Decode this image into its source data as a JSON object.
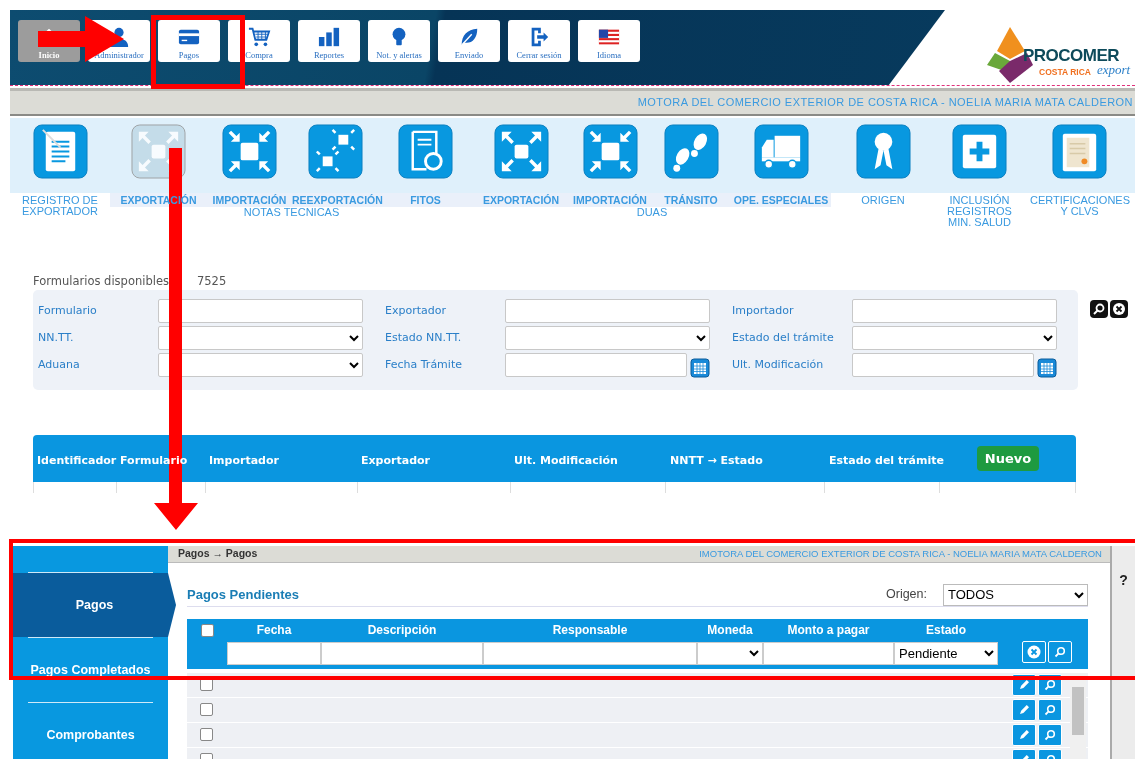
{
  "toolbar": [
    {
      "label": "Inicio",
      "selected": true
    },
    {
      "label": "Administrador",
      "selected": false
    },
    {
      "label": "Pagos",
      "selected": false
    },
    {
      "label": "Compra",
      "selected": false
    },
    {
      "label": "Reportes",
      "selected": false
    },
    {
      "label": "Not. y alertas",
      "selected": false
    },
    {
      "label": "Enviado",
      "selected": false
    },
    {
      "label": "Cerrar sesión",
      "selected": false
    },
    {
      "label": "Idioma",
      "selected": false
    }
  ],
  "logo": {
    "name": "PROCOMER",
    "tagline": "COSTA RICA",
    "script": "export"
  },
  "user_bar": "MOTORA DEL COMERCIO EXTERIOR DE COSTA RICA - NOELIA MARIA MATA CALDERON",
  "modules": [
    {
      "kind": "single",
      "label": "REGISTRO DE EXPORTADOR",
      "disabled": false
    },
    {
      "kind": "group",
      "caption": "NOTAS TECNICAS",
      "items": [
        {
          "label": "EXPORTACIÓN",
          "disabled": true
        },
        {
          "label": "IMPORTACIÓN",
          "disabled": false
        },
        {
          "label": "REEXPORTACIÓN",
          "disabled": false
        },
        {
          "label": "FITOS",
          "disabled": false
        }
      ]
    },
    {
      "kind": "group",
      "caption": "DUAS",
      "items": [
        {
          "label": "EXPORTACIÓN",
          "disabled": false
        },
        {
          "label": "IMPORTACIÓN",
          "disabled": false
        },
        {
          "label": "TRÁNSITO",
          "disabled": false
        },
        {
          "label": "OPE. ESPECIALES",
          "disabled": false
        }
      ]
    },
    {
      "kind": "single",
      "label": "ORIGEN",
      "disabled": false
    },
    {
      "kind": "single",
      "label": "INCLUSIÓN REGISTROS MIN. SALUD",
      "disabled": false
    },
    {
      "kind": "single",
      "label": "CERTIFICACIONES Y CLVS",
      "disabled": false
    }
  ],
  "available": {
    "label": "Formularios disponibles",
    "count": "7525"
  },
  "filters": [
    {
      "label": "Formulario",
      "kind": "text"
    },
    {
      "label": "Exportador",
      "kind": "text"
    },
    {
      "label": "Importador",
      "kind": "text"
    },
    {
      "label": "NN.TT.",
      "kind": "select"
    },
    {
      "label": "Estado NN.TT.",
      "kind": "select"
    },
    {
      "label": "Estado del trámite",
      "kind": "select"
    },
    {
      "label": "Aduana",
      "kind": "select"
    },
    {
      "label": "Fecha Trámite",
      "kind": "date"
    },
    {
      "label": "Ult. Modificación",
      "kind": "date"
    }
  ],
  "forms_table": {
    "columns": [
      "Identificador",
      "Formulario",
      "Importador",
      "Exportador",
      "Ult. Modificación",
      "NNTT → Estado",
      "Estado del trámite"
    ],
    "new_button": "Nuevo"
  },
  "payments": {
    "breadcrumb": "Pagos → Pagos",
    "user_bar": "IMOTORA DEL COMERCIO EXTERIOR DE COSTA RICA - NOELIA MARIA MATA CALDERON",
    "help": "?",
    "menu": [
      {
        "label": "Pagos",
        "selected": true
      },
      {
        "label": "Pagos Completados",
        "selected": false
      },
      {
        "label": "Comprobantes",
        "selected": false
      }
    ],
    "title": "Pagos Pendientes",
    "origin": {
      "label": "Origen:",
      "value": "TODOS"
    },
    "select_all": {
      "checked": false
    },
    "columns": [
      {
        "label": "Fecha",
        "kind": "text"
      },
      {
        "label": "Descripción",
        "kind": "text"
      },
      {
        "label": "Responsable",
        "kind": "text"
      },
      {
        "label": "Moneda",
        "kind": "select"
      },
      {
        "label": "Monto a pagar",
        "kind": "text"
      },
      {
        "label": "Estado",
        "kind": "select",
        "value": "Pendiente"
      }
    ],
    "rows": [
      {
        "checked": false
      },
      {
        "checked": false
      },
      {
        "checked": false
      },
      {
        "checked": false
      }
    ]
  }
}
